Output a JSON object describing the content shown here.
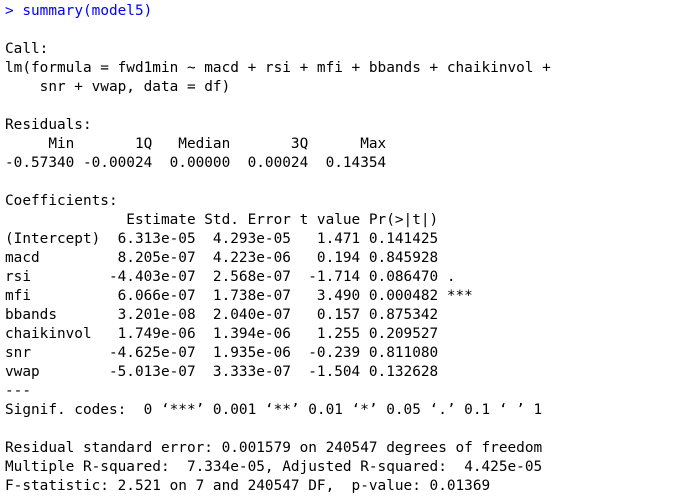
{
  "console": {
    "prompt_symbol": ">",
    "command": "summary(model5)",
    "call": {
      "header": "Call:",
      "line1": "lm(formula = fwd1min ~ macd + rsi + mfi + bbands + chaikinvol +",
      "line2": "    snr + vwap, data = df)"
    },
    "residuals": {
      "header": "Residuals:",
      "labels_line": "     Min       1Q   Median       3Q      Max ",
      "values_line": "-0.57340 -0.00024  0.00000  0.00024  0.14354 "
    },
    "coefficients": {
      "header": "Coefficients:",
      "column_header_line": "              Estimate Std. Error t value Pr(>|t|)    ",
      "rows": [
        "(Intercept)  6.313e-05  4.293e-05   1.471 0.141425    ",
        "macd         8.205e-07  4.223e-06   0.194 0.845928    ",
        "rsi         -4.403e-07  2.568e-07  -1.714 0.086470 .  ",
        "mfi          6.066e-07  1.738e-07   3.490 0.000482 ***",
        "bbands       3.201e-08  2.040e-07   0.157 0.875342    ",
        "chaikinvol   1.749e-06  1.394e-06   1.255 0.209527    ",
        "snr         -4.625e-07  1.935e-06  -0.239 0.811080    ",
        "vwap        -5.013e-07  3.333e-07  -1.504 0.132628    "
      ],
      "separator": "---",
      "signif_codes": "Signif. codes:  0 ‘***’ 0.001 ‘**’ 0.01 ‘*’ 0.05 ‘.’ 0.1 ‘ ’ 1"
    },
    "summary": {
      "residual_se": "Residual standard error: 0.001579 on 240547 degrees of freedom",
      "r_squared": "Multiple R-squared:  7.334e-05,\tAdjusted R-squared:  4.425e-05 ",
      "f_statistic": "F-statistic: 2.521 on 7 and 240547 DF,  p-value: 0.01369"
    }
  },
  "colors": {
    "prompt": "#0000ff",
    "output": "#000000",
    "background": "#ffffff"
  }
}
